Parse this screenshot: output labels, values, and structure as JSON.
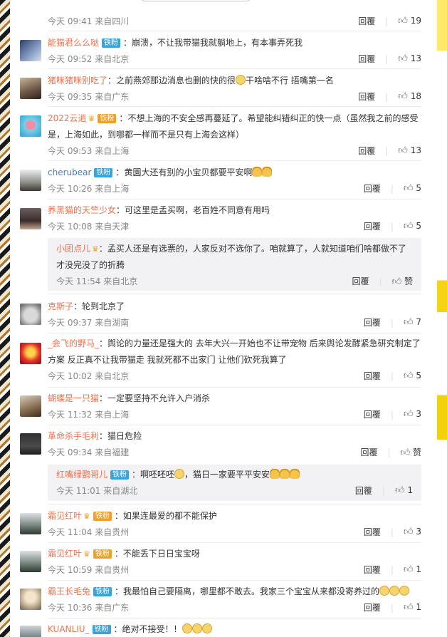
{
  "top": {
    "search_icon": "search-icon"
  },
  "reply_label": "回覆",
  "comments": [
    {
      "meta": "今天 09:41 来自四川",
      "likes": "19"
    },
    {
      "name": "能猫君么么哒",
      "badge": "铁粉",
      "text": "崩溃，不让我带猫我就躺地上，有本事弄死我",
      "meta": "今天 09:52 来自北京",
      "likes": "13"
    },
    {
      "name": "猪咪猪咪别吃了",
      "text_a": "之前燕郊那边消息也删的快的很",
      "text_b": "干啥啥不行 捂嘴第一名",
      "meta": "今天 09:35 来自广东",
      "likes": "18"
    },
    {
      "name": "2022云逍",
      "badge": "铁粉",
      "text": "不想上海的不安全感再蔓延了。希望能纠错纠正的快一点（虽然我之前的感受是，上海如此，到哪都一样而不是只有上海会这样）",
      "meta": "今天 09:53 来自上海",
      "likes": "13"
    },
    {
      "name": "cherubear",
      "badge": "铁粉",
      "text": "黄園大还有别的小宝贝都要平安啊",
      "meta": "今天 10:26 来自上海",
      "likes": "5"
    },
    {
      "name": "养黑猫的天竺少女",
      "text": "可这里是孟买啊，老百姓不同意有用吗",
      "meta": "今天 10:08 来自天津",
      "likes": "5"
    },
    {
      "name": "小团点儿",
      "text": "孟买人还是有选票的，人家反对不选你了。咱就算了，人就知道咱们啥都做不了才没完没了的折腾",
      "meta": "今天 11:54 来自北京",
      "likes": "赞"
    },
    {
      "name": "克斯子",
      "text": "轮到北京了",
      "meta": "今天 09:37 来自湖南",
      "likes": "7"
    },
    {
      "name": "_会飞的野马_",
      "text": "舆论的力量还是强大的 去年大兴一开始也不让带宠物 后来舆论发酵紧急研究制定了方案 反正真不让我带猫走 我就死都不出家门 让他们砍死我算了",
      "meta": "今天 10:02 来自北京",
      "likes": "5"
    },
    {
      "name": "蝴蝶是一只猫",
      "text": "一定要坚持不允许入户消杀",
      "meta": "今天 11:32 来自上海",
      "likes": "3"
    },
    {
      "name": "革命杀手毛利",
      "text": "猫日危险",
      "meta": "今天 09:34 来自福建",
      "likes": "赞"
    },
    {
      "name": "红嘴绿鹦哥儿",
      "badge": "铁粉",
      "text_a": "啊呸呸呸",
      "text_b": "，猫日一家要平平安安",
      "meta": "今天 11:01 来自湖北",
      "likes": "1"
    },
    {
      "name": "霜见红叶",
      "badge": "铁粉",
      "text": "如果连最爱的都不能保护",
      "meta": "今天 11:04 来自贵州",
      "likes": "3"
    },
    {
      "name": "霜见红叶",
      "badge": "铁粉",
      "text": "不能丢下日日宝宝呀",
      "meta": "今天 10:59 来自贵州",
      "likes": "1"
    },
    {
      "name": "霸王长毛兔",
      "badge": "铁粉",
      "text": "我最怕自己要隔离，哪里都不敢去。我家三个宝宝从来都没寄养过的",
      "meta": "今天 10:36 来自广东",
      "likes": "1"
    },
    {
      "name": "KUANLIU_",
      "badge": "铁粉",
      "text": "绝对不接受！！"
    }
  ]
}
